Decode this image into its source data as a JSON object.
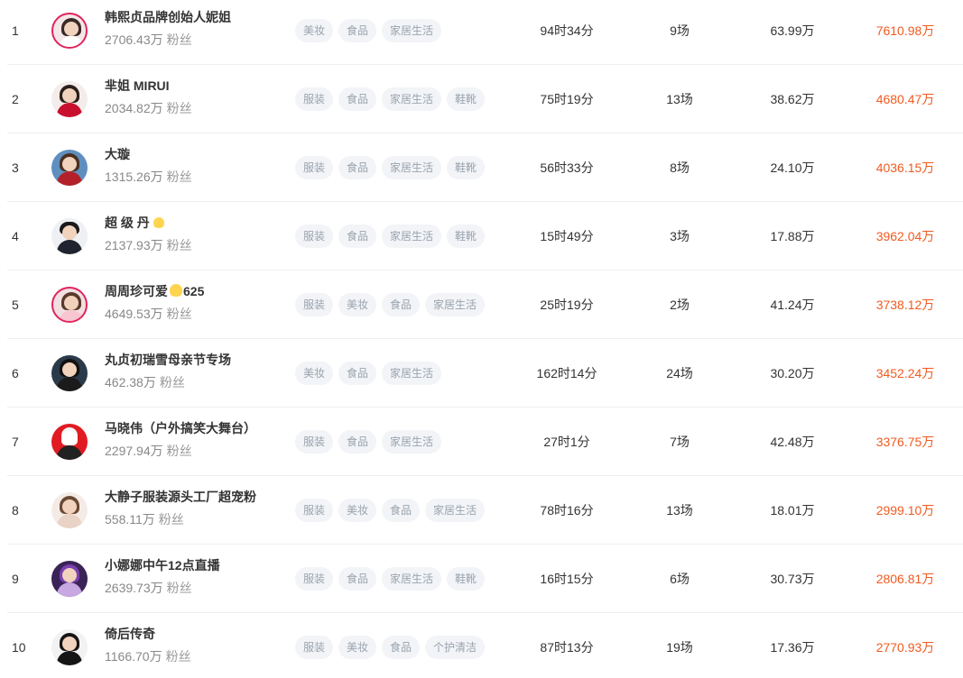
{
  "colors": {
    "accent_gmv": "#f25a1f",
    "tag_bg": "#f2f4f7",
    "tag_text": "#9aa3ae",
    "avatar_ring": "#e0245e"
  },
  "fans_unit": "粉丝",
  "rows": [
    {
      "rank": "1",
      "name": "韩熙贞品牌创始人妮姐",
      "fans": "2706.43万",
      "tags": [
        "美妆",
        "食品",
        "家居生活"
      ],
      "duration": "94时34分",
      "sessions": "9场",
      "sales": "63.99万",
      "gmv": "7610.98万"
    },
    {
      "rank": "2",
      "name": "芈姐 MIRUI",
      "fans": "2034.82万",
      "tags": [
        "服装",
        "食品",
        "家居生活",
        "鞋靴"
      ],
      "duration": "75时19分",
      "sessions": "13场",
      "sales": "38.62万",
      "gmv": "4680.47万"
    },
    {
      "rank": "3",
      "name": "大璇",
      "fans": "1315.26万",
      "tags": [
        "服装",
        "食品",
        "家居生活",
        "鞋靴"
      ],
      "duration": "56时33分",
      "sessions": "8场",
      "sales": "24.10万",
      "gmv": "4036.15万"
    },
    {
      "rank": "4",
      "name": "超 级 丹",
      "fans": "2137.93万",
      "tags": [
        "服装",
        "食品",
        "家居生活",
        "鞋靴"
      ],
      "duration": "15时49分",
      "sessions": "3场",
      "sales": "17.88万",
      "gmv": "3962.04万"
    },
    {
      "rank": "5",
      "name": "周周珍可爱",
      "name_suffix": "625",
      "fans": "4649.53万",
      "tags": [
        "服装",
        "美妆",
        "食品",
        "家居生活"
      ],
      "duration": "25时19分",
      "sessions": "2场",
      "sales": "41.24万",
      "gmv": "3738.12万"
    },
    {
      "rank": "6",
      "name": "丸贞初瑞雪母亲节专场",
      "fans": "462.38万",
      "tags": [
        "美妆",
        "食品",
        "家居生活"
      ],
      "duration": "162时14分",
      "sessions": "24场",
      "sales": "30.20万",
      "gmv": "3452.24万"
    },
    {
      "rank": "7",
      "name": "马晓伟（户外搞笑大舞台）",
      "fans": "2297.94万",
      "tags": [
        "服装",
        "食品",
        "家居生活"
      ],
      "duration": "27时1分",
      "sessions": "7场",
      "sales": "42.48万",
      "gmv": "3376.75万"
    },
    {
      "rank": "8",
      "name": "大静子服装源头工厂超宠粉",
      "fans": "558.11万",
      "tags": [
        "服装",
        "美妆",
        "食品",
        "家居生活"
      ],
      "duration": "78时16分",
      "sessions": "13场",
      "sales": "18.01万",
      "gmv": "2999.10万"
    },
    {
      "rank": "9",
      "name": "小娜娜中午12点直播",
      "fans": "2639.73万",
      "tags": [
        "服装",
        "食品",
        "家居生活",
        "鞋靴"
      ],
      "duration": "16时15分",
      "sessions": "6场",
      "sales": "30.73万",
      "gmv": "2806.81万"
    },
    {
      "rank": "10",
      "name": "倚后传奇",
      "fans": "1166.70万",
      "tags": [
        "服装",
        "美妆",
        "食品",
        "个护清洁"
      ],
      "duration": "87时13分",
      "sessions": "19场",
      "sales": "17.36万",
      "gmv": "2770.93万"
    }
  ]
}
